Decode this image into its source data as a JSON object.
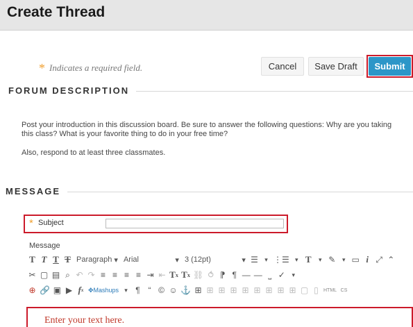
{
  "page": {
    "title": "Create Thread",
    "required_note": "Indicates a required field.",
    "required_star": "*"
  },
  "buttons": {
    "cancel": "Cancel",
    "save_draft": "Save Draft",
    "submit": "Submit"
  },
  "forum_description": {
    "heading": "FORUM DESCRIPTION",
    "paragraph1_line1": "Post your introduction in this discussion board. Be sure to answer the following questions: Why are you taking",
    "paragraph1_line2": "this class? What is your favorite thing to do in your free time?",
    "paragraph2": "Also, respond to at least three classmates."
  },
  "message": {
    "heading": "MESSAGE",
    "subject_label": "Subject",
    "subject_value": "",
    "message_label": "Message",
    "editor_placeholder": "Enter your text here."
  },
  "toolbar": {
    "format_select": "Paragraph",
    "font_select": "Arial",
    "size_select": "3 (12pt)",
    "mashups_label": "Mashups",
    "html_label": "HTML",
    "css_label": "CS"
  },
  "colors": {
    "accent_red": "#cc1a2a",
    "submit_blue": "#2c96c8",
    "required_orange": "#f0a030"
  }
}
